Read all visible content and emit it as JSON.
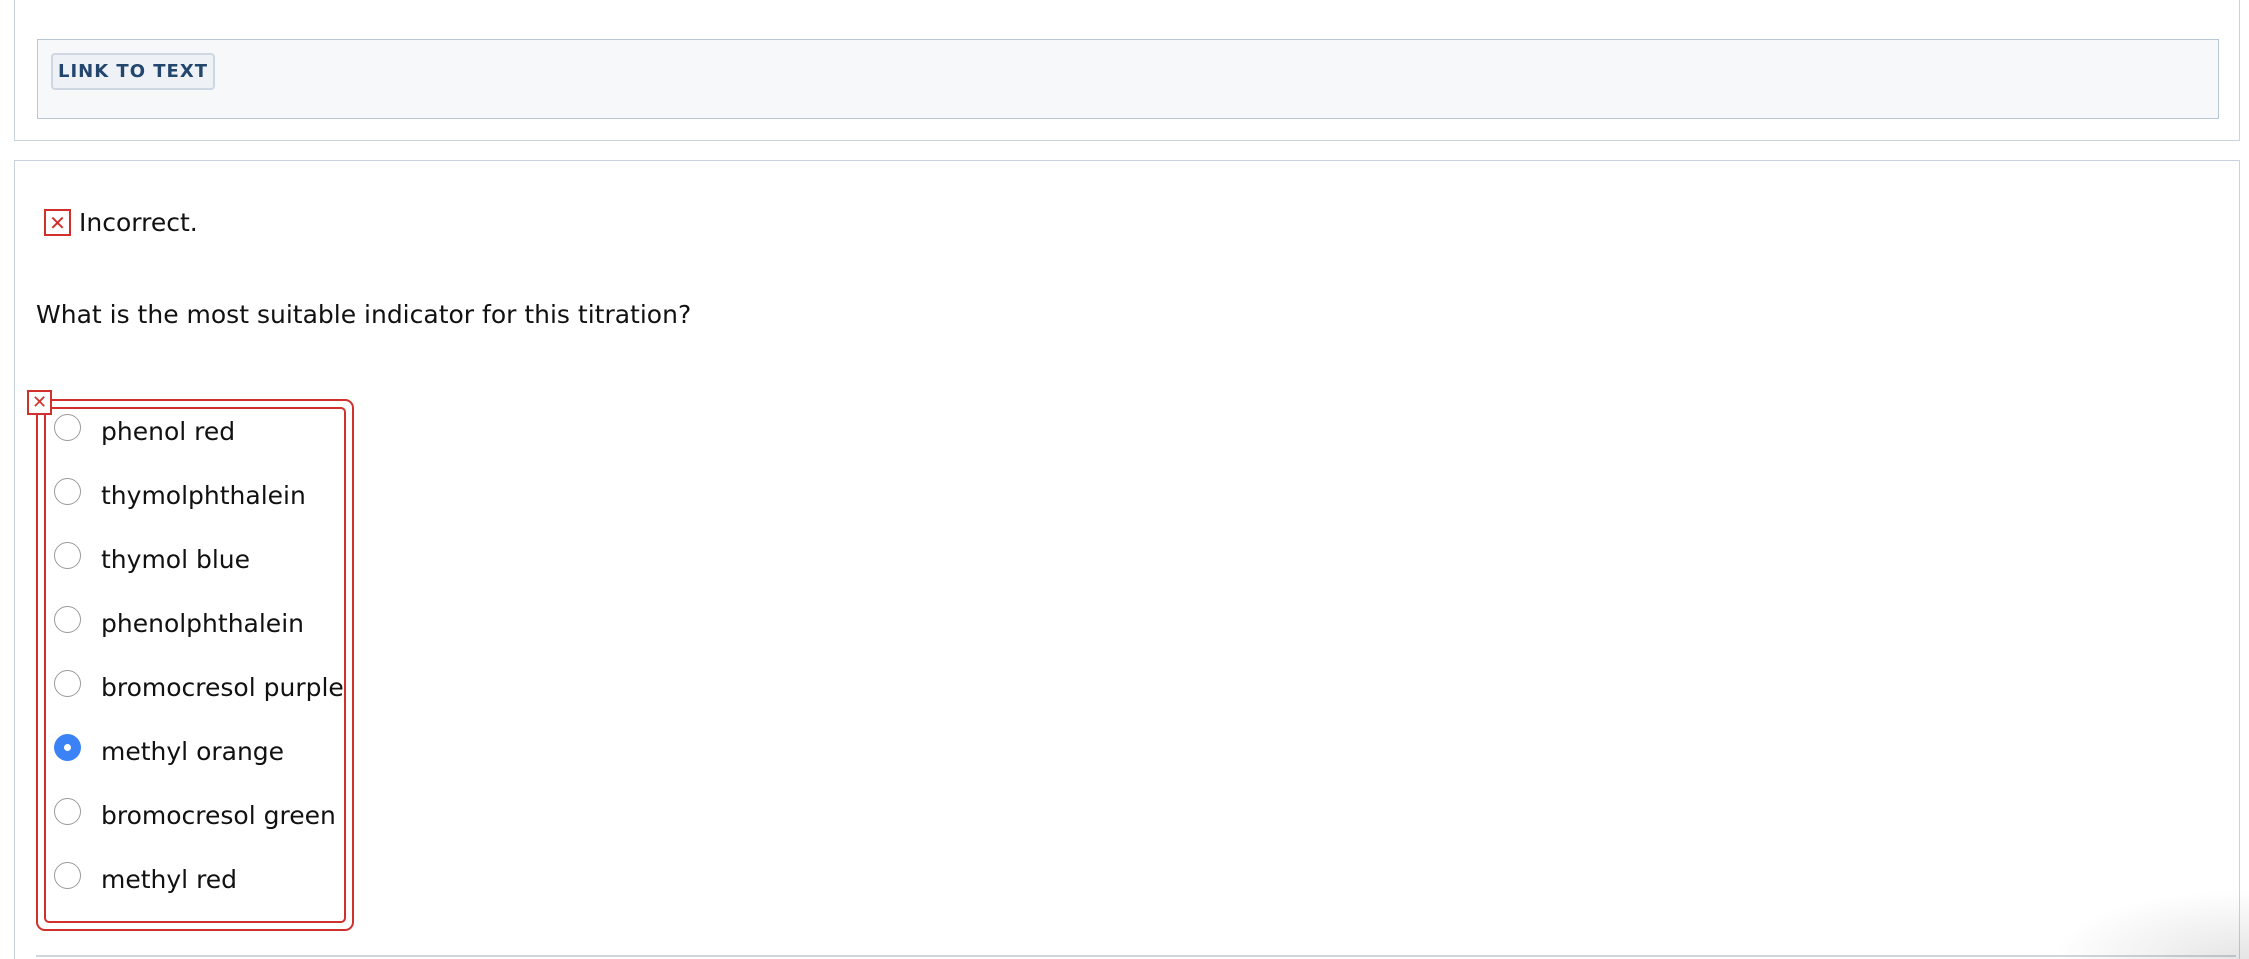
{
  "link_to_text": {
    "label": "LINK TO TEXT"
  },
  "feedback": {
    "icon": "x-mark-icon",
    "text": "Incorrect."
  },
  "question": {
    "text": "What is the most suitable indicator for this titration?"
  },
  "answer_group": {
    "status_icon": "x-mark-icon",
    "selected": "methyl orange",
    "options": [
      {
        "label": "phenol red",
        "checked": false
      },
      {
        "label": "thymolphthalein",
        "checked": false
      },
      {
        "label": "thymol blue",
        "checked": false
      },
      {
        "label": "phenolphthalein",
        "checked": false
      },
      {
        "label": "bromocresol purple",
        "checked": false
      },
      {
        "label": "methyl orange",
        "checked": true
      },
      {
        "label": "bromocresol green",
        "checked": false
      },
      {
        "label": "methyl red",
        "checked": false
      }
    ]
  },
  "colors": {
    "error_red": "#d2302c",
    "radio_selected_blue": "#3b82f6",
    "button_text": "#23466f",
    "panel_border": "#c9d3de"
  }
}
